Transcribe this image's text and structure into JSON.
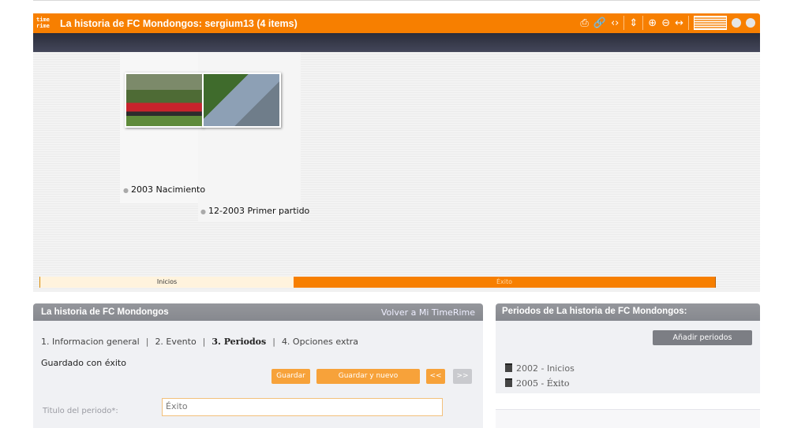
{
  "timeline": {
    "logo_top": "time",
    "logo_bottom": "rime",
    "title": "La historia de FC Mondongos: sergium13  (4 items)",
    "toolbar_icons": [
      "print-icon",
      "link-icon",
      "embed-code-icon",
      "vertical-resize-icon",
      "zoom-in-icon",
      "zoom-out-icon",
      "horizontal-resize-icon",
      "lines-icon",
      "minimize-icon",
      "close-icon"
    ],
    "events": [
      {
        "label": "2003 Nacimiento"
      },
      {
        "label": "12-2003 Primer partido"
      }
    ],
    "periods_bar": {
      "inicios": "Inicios",
      "exito": "Éxito"
    }
  },
  "form": {
    "title": "La historia de FC Mondongos",
    "back_link": "Volver a Mi TimeRime",
    "steps": {
      "s1": "1. Informacion general",
      "s2": "2. Evento",
      "s3": "3. Periodos",
      "s4": "4. Opciones extra",
      "sep": "|"
    },
    "saved_message": "Guardado con éxito",
    "buttons": {
      "save": "Guardar",
      "save_new": "Guardar y nuevo",
      "prev": "<<",
      "next": ">>"
    },
    "field_label": "Titulo del periodo*:",
    "field_value": "Éxito"
  },
  "periods_panel": {
    "title": "Periodos de La historia de FC Mondongos:",
    "add_button": "Añadir periodos",
    "items": [
      {
        "label": "2002 - Inicios"
      },
      {
        "label": "2005 - Éxito"
      }
    ]
  },
  "colors": {
    "accent": "#f77f00",
    "panel_header": "#8e9095",
    "button_orange": "#f7a23a"
  }
}
